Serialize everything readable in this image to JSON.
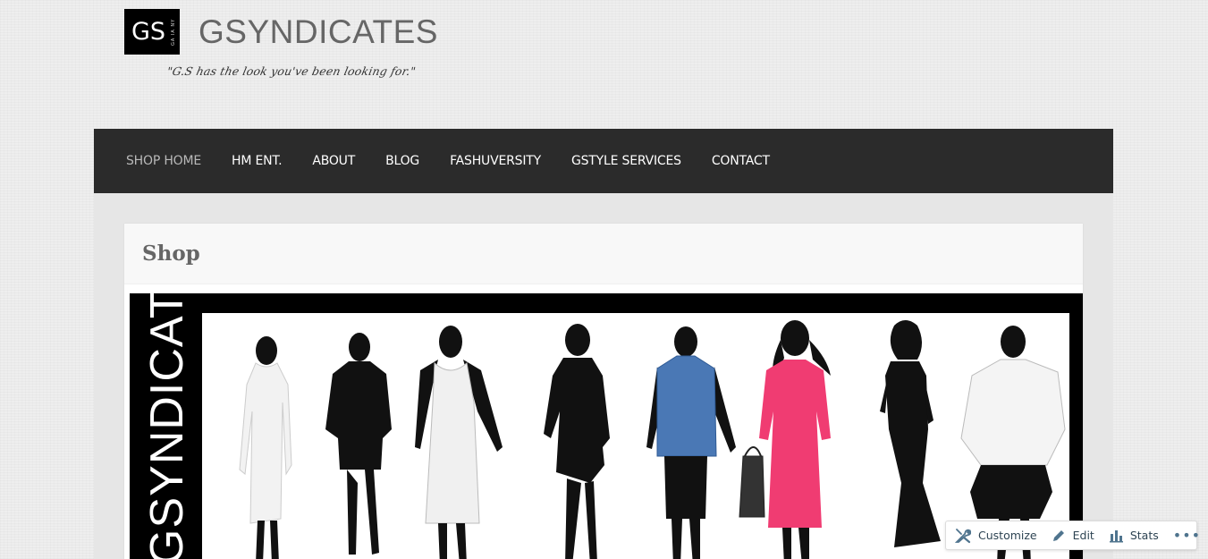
{
  "header": {
    "logo_text": "GS",
    "logo_subtext": "GA IA NY",
    "site_title": "GSYNDICATES",
    "tagline": "\"G.S has the look you've been looking for.\""
  },
  "nav": {
    "items": [
      {
        "label": "SHOP HOME",
        "active": true
      },
      {
        "label": "HM ENT."
      },
      {
        "label": "ABOUT"
      },
      {
        "label": "BLOG"
      },
      {
        "label": "FASHUVERSITY"
      },
      {
        "label": "GSTYLE SERVICES"
      },
      {
        "label": "CONTACT"
      }
    ]
  },
  "main": {
    "page_title": "Shop",
    "banner_text": "GSYNDICATES"
  },
  "admin_bar": {
    "customize_label": "Customize",
    "edit_label": "Edit",
    "stats_label": "Stats",
    "more_label": "•••"
  },
  "colors": {
    "nav_bg": "#2b2b2b",
    "active_nav": "#b9b9b9",
    "page_bg": "#eeeeee",
    "content_bg": "#e6e6e6",
    "blue_top": "#4a78b5",
    "pink_dress": "#f03c72"
  }
}
